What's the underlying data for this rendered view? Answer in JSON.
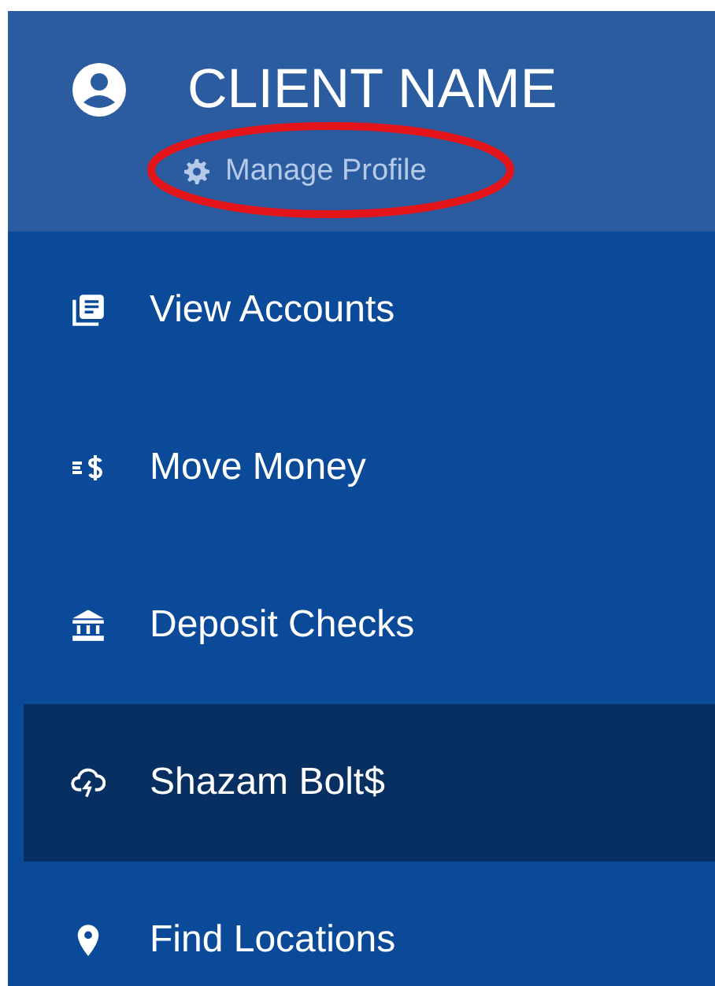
{
  "header": {
    "client_name": "CLIENT NAME",
    "manage_profile": {
      "label": "Manage Profile",
      "circled": true
    }
  },
  "menu": [
    {
      "label": "View Accounts",
      "kind": "accounts",
      "selected": false
    },
    {
      "label": "Move Money",
      "kind": "money",
      "selected": false
    },
    {
      "label": "Deposit Checks",
      "kind": "bank",
      "selected": false
    },
    {
      "label": "Shazam Bolt$",
      "kind": "cloud",
      "selected": true
    },
    {
      "label": "Find Locations",
      "kind": "pin",
      "selected": false
    }
  ]
}
